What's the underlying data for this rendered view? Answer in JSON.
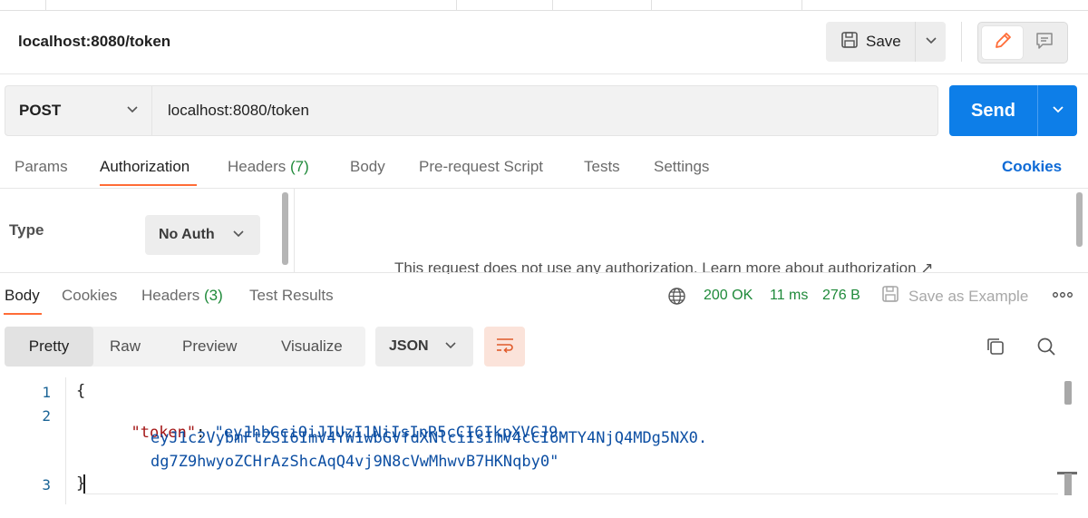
{
  "request": {
    "title": "localhost:8080/token",
    "save_label": "Save",
    "method": "POST",
    "url": "localhost:8080/token",
    "send_label": "Send"
  },
  "request_tabs": {
    "params": "Params",
    "authorization": "Authorization",
    "headers": "Headers",
    "headers_count": "(7)",
    "body": "Body",
    "prerequest": "Pre-request Script",
    "tests": "Tests",
    "settings": "Settings",
    "cookies": "Cookies"
  },
  "auth": {
    "type_label": "Type",
    "type_value": "No Auth",
    "note": "This request does not use any authorization. Learn more about authorization ↗"
  },
  "response_tabs": {
    "body": "Body",
    "cookies": "Cookies",
    "headers": "Headers",
    "headers_count": "(3)",
    "test_results": "Test Results"
  },
  "response_status": {
    "status": "200 OK",
    "time": "11 ms",
    "size": "276 B",
    "save_example": "Save as Example"
  },
  "view_options": {
    "pretty": "Pretty",
    "raw": "Raw",
    "preview": "Preview",
    "visualize": "Visualize",
    "format": "JSON"
  },
  "response_body": {
    "line_numbers": [
      "1",
      "2",
      "3"
    ],
    "open_brace": "{",
    "key": "\"token\"",
    "colon": ": ",
    "token_line1": "\"eyJhbGciOiJIUzI1NiIsInR5cCI6IkpXVCJ9.",
    "token_line2": "eyJ1c2VybmFtZSI6ImV4YW1wbGVfdXNlciIsImV4cCI6MTY4NjQ4MDg5NX0.",
    "token_line3": "dg7Z9hwyoZCHrAzShcAqQ4vj9N8cVwMhwvB7HKNqby0\"",
    "close_brace": "}"
  },
  "colors": {
    "accent_orange": "#ff6c37",
    "send_blue": "#0d7ee8",
    "status_green": "#1f8a3a",
    "link_blue": "#0d6ad6"
  }
}
